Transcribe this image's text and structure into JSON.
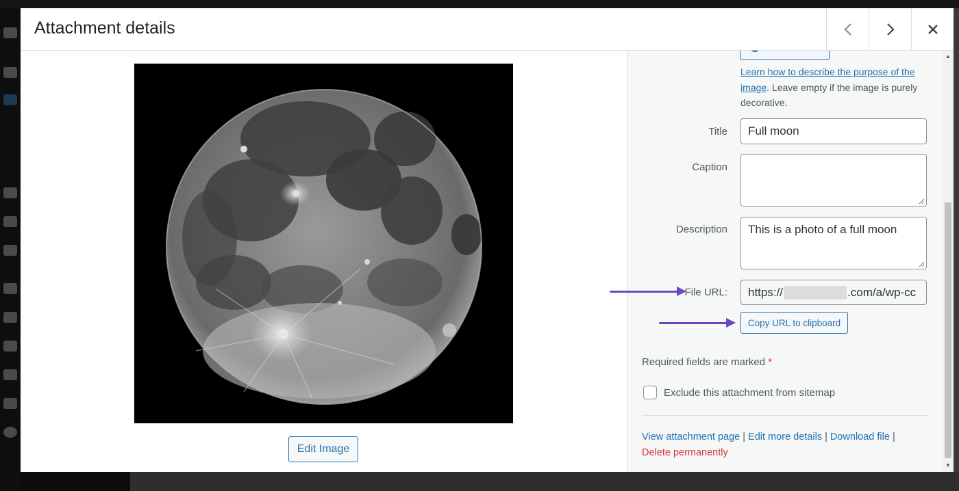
{
  "modal": {
    "title": "Attachment details"
  },
  "header_buttons": {
    "previous_icon": "chevron-left-icon",
    "next_icon": "chevron-right-icon",
    "close_icon": "close-icon"
  },
  "media": {
    "image_subject": "moon-image",
    "edit_label": "Edit Image"
  },
  "alt_help": {
    "link_text": "Learn how to describe the purpose of the image",
    "rest_text": ". Leave empty if the image is purely decorative."
  },
  "fields": {
    "title_label": "Title",
    "title_value": "Full moon",
    "caption_label": "Caption",
    "caption_value": "",
    "description_label": "Description",
    "description_value": "This is a photo of a full moon",
    "file_url_label": "File URL:",
    "file_url_prefix": "https://",
    "file_url_suffix": ".com/a/wp-cc"
  },
  "copy_button": "Copy URL to clipboard",
  "required_note": {
    "text": "Required fields are marked ",
    "star": "*"
  },
  "sitemap_checkbox": {
    "label": "Exclude this attachment from sitemap",
    "checked": false
  },
  "actions": {
    "view": "View attachment page",
    "edit": "Edit more details",
    "download": "Download file",
    "separator": " | ",
    "delete": "Delete permanently"
  },
  "colors": {
    "accent": "#2271b1",
    "danger": "#d63638",
    "annotation_arrow": "#6b46c1"
  }
}
